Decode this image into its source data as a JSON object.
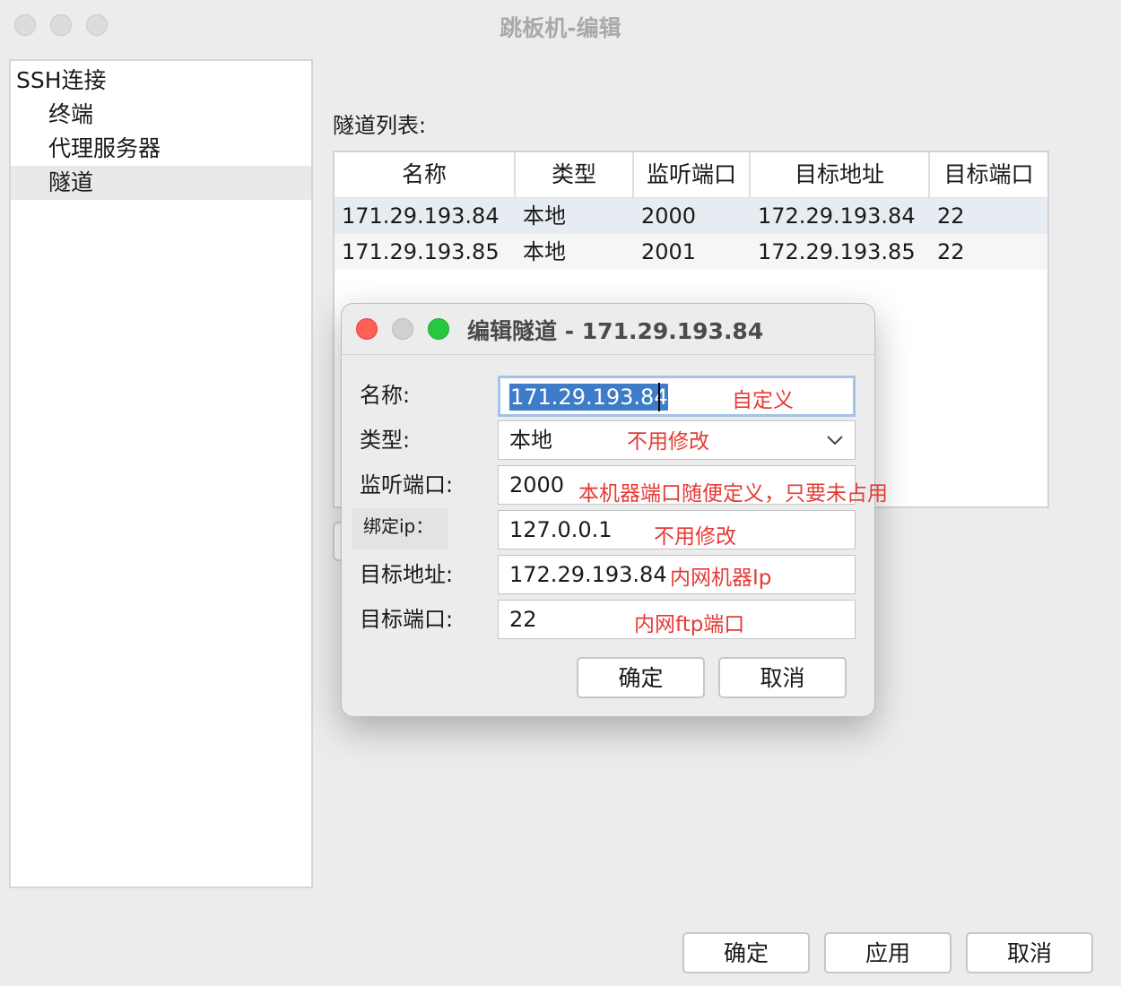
{
  "window": {
    "title": "跳板机-编辑"
  },
  "sidebar": {
    "items": [
      {
        "label": "SSH连接"
      },
      {
        "label": "终端"
      },
      {
        "label": "代理服务器"
      },
      {
        "label": "隧道"
      }
    ]
  },
  "tunnel_list": {
    "label": "隧道列表:",
    "columns": [
      "名称",
      "类型",
      "监听端口",
      "目标地址",
      "目标端口"
    ],
    "rows": [
      [
        "171.29.193.84",
        "本地",
        "2000",
        "172.29.193.84",
        "22"
      ],
      [
        "171.29.193.85",
        "本地",
        "2001",
        "172.29.193.85",
        "22"
      ]
    ]
  },
  "dialog": {
    "title": "编辑隧道 - 171.29.193.84",
    "fields": [
      {
        "label": "名称:",
        "value": "171.29.193.84",
        "annotation": "自定义"
      },
      {
        "label": "类型:",
        "value": "本地",
        "annotation": "不用修改"
      },
      {
        "label": "监听端口:",
        "value": "2000",
        "annotation": "本机器端口随便定义，只要未占用"
      },
      {
        "label": "绑定ip：",
        "value": "127.0.0.1",
        "annotation": "不用修改"
      },
      {
        "label": "目标地址:",
        "value": "172.29.193.84",
        "annotation": "内网机器Ip"
      },
      {
        "label": "目标端口:",
        "value": "22",
        "annotation": "内网ftp端口"
      }
    ],
    "buttons": {
      "ok": "确定",
      "cancel": "取消"
    }
  },
  "footer": {
    "ok": "确定",
    "apply": "应用",
    "cancel": "取消"
  },
  "colors": {
    "annotation": "#e63a35",
    "selection": "#3f7cc7",
    "close": "#fe5f57",
    "minimize": "#d0d0d0",
    "maximize": "#27c840"
  }
}
